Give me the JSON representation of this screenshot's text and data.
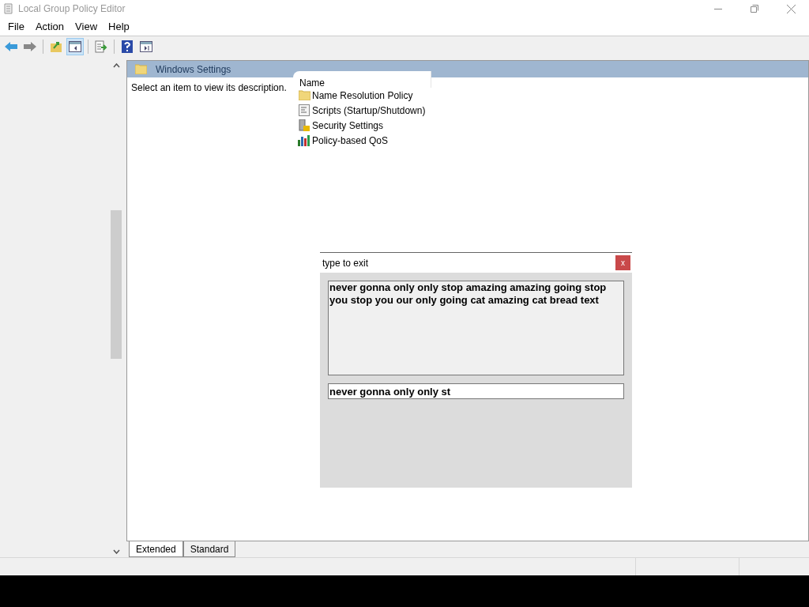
{
  "window": {
    "title": "Local Group Policy Editor"
  },
  "menu": [
    "File",
    "Action",
    "View",
    "Help"
  ],
  "toolbar": [
    {
      "kind": "back",
      "pressed": false
    },
    {
      "kind": "forward",
      "pressed": false
    },
    {
      "kind": "up",
      "pressed": false
    },
    {
      "kind": "tree",
      "pressed": true
    },
    {
      "kind": "export",
      "pressed": false
    },
    {
      "kind": "help",
      "pressed": false
    },
    {
      "kind": "pane",
      "pressed": false
    }
  ],
  "panel": {
    "title": "Windows Settings",
    "description": "Select an item to view its description.",
    "column": "Name",
    "items": [
      {
        "label": "Name Resolution Policy",
        "kind": "folder"
      },
      {
        "label": "Scripts (Startup/Shutdown)",
        "kind": "script"
      },
      {
        "label": "Security Settings",
        "kind": "security"
      },
      {
        "label": "Policy-based QoS",
        "kind": "chart"
      }
    ]
  },
  "tabs": [
    {
      "label": "Extended",
      "selected": true
    },
    {
      "label": "Standard",
      "selected": false
    }
  ],
  "dialog": {
    "title": "type to exit",
    "close": "x",
    "prompt": "never gonna only only stop amazing amazing going stop you stop you our only going cat amazing cat bread text",
    "value": "never gonna only only st"
  }
}
